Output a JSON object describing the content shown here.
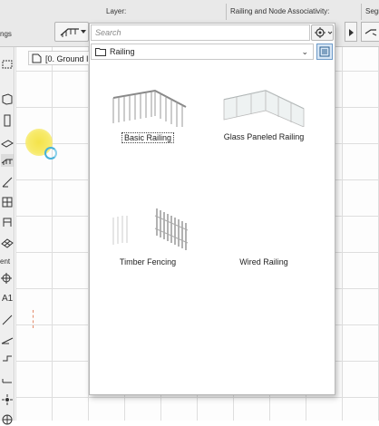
{
  "topbar": {
    "left_label": "ngs",
    "layer_label": "Layer:",
    "railing_assoc_label": "Railing and Node Associativity:",
    "segm_label": "Segn"
  },
  "story": {
    "label": "[0. Ground I"
  },
  "toolbox": {
    "section_label": "ent",
    "a1_label": "A1"
  },
  "popup": {
    "search_placeholder": "Search",
    "folder_label": "Railing",
    "folder_caret": "⌄",
    "items": [
      {
        "label": "Basic Railing",
        "selected": true
      },
      {
        "label": "Glass Paneled Railing",
        "selected": false
      },
      {
        "label": "Timber Fencing",
        "selected": false
      },
      {
        "label": "Wired Railing",
        "selected": false
      }
    ]
  },
  "colors": {
    "accent": "#47b2d9",
    "cursor_highlight": "#f4e34a",
    "selected_view_btn": "#d7e6f5"
  },
  "icons": [
    "railing-tool-icon",
    "gear-icon",
    "folder-icon",
    "list-view-icon",
    "document-icon"
  ]
}
